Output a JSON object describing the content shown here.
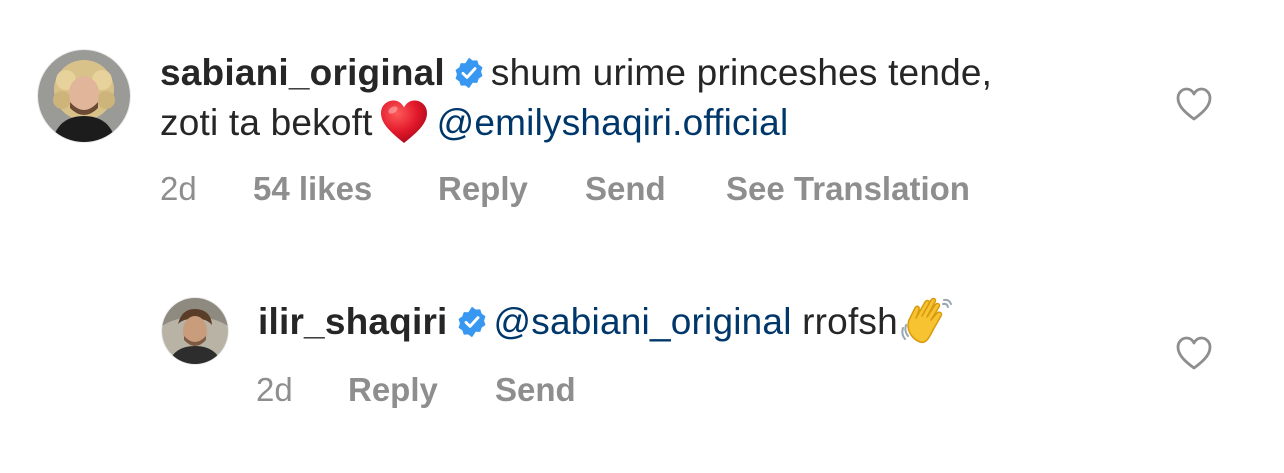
{
  "comments": [
    {
      "username": "sabiani_original",
      "text_before": "shum urime princeshes tende,",
      "text_line2": "zoti ta bekoft",
      "mention": "@emilyshaqiri.official",
      "emoji": "red-heart-emoji",
      "age": "2d",
      "likes": "54 likes",
      "reply": "Reply",
      "send": "Send",
      "translate": "See Translation"
    },
    {
      "username": "ilir_shaqiri",
      "mention": "@sabiani_original",
      "text_after": "rrofsh",
      "emoji": "waving-hand-emoji",
      "age": "2d",
      "reply": "Reply",
      "send": "Send"
    }
  ],
  "icons": {
    "verified": "verified-badge-icon",
    "like": "heart-outline-icon"
  },
  "colors": {
    "text": "#262626",
    "meta": "#8e8e8e",
    "mention": "#00376b",
    "verified": "#3897f0"
  }
}
